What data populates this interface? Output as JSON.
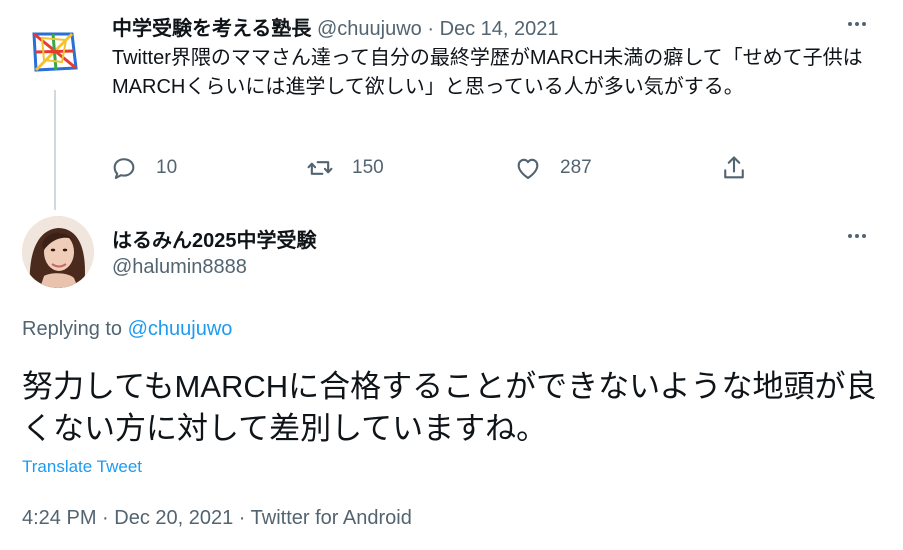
{
  "original_tweet": {
    "display_name": "中学受験を考える塾長",
    "handle": "@chuujuwo",
    "separator": " · ",
    "date": "Dec 14, 2021",
    "text": "Twitter界隈のママさん達って自分の最終学歴がMARCH未満の癖して「せめて子供はMARCHくらいには進学して欲しい」と思っている人が多い気がする。",
    "actions": {
      "reply_icon": "reply-icon",
      "reply_count": "10",
      "retweet_icon": "retweet-icon",
      "retweet_count": "150",
      "like_icon": "heart-icon",
      "like_count": "287",
      "share_icon": "share-icon"
    },
    "avatar_colors": [
      "#e63c2f",
      "#2a6fd6",
      "#f2c230",
      "#3aa84a"
    ]
  },
  "reply_tweet": {
    "display_name": "はるみん2025中学受験",
    "handle": "@halumin8888",
    "replying_label": "Replying to",
    "replying_to": "@chuujuwo",
    "text": "努力してもMARCHに合格することができないような地頭が良くない方に対して差別していますね。",
    "translate_label": "Translate Tweet",
    "timestamp": "4:24 PM · Dec 20, 2021 · Twitter for Android"
  },
  "colors": {
    "accent": "#1d9bf0",
    "muted": "#536471",
    "text": "#0f1419",
    "thread_line": "#cfd9de"
  }
}
